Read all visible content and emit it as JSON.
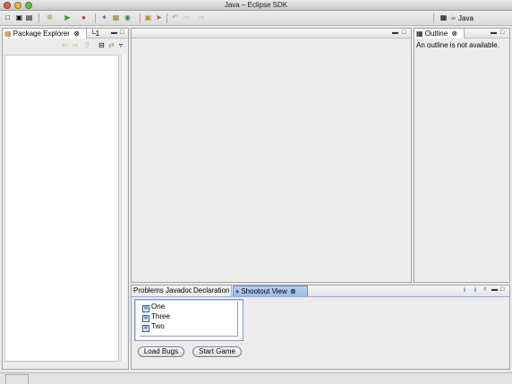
{
  "window": {
    "title": "Java – Eclipse SDK"
  },
  "toolbar": {
    "perspective_label": "Java",
    "icons": [
      "new-icon",
      "save-icon",
      "print-icon",
      "debug-icon",
      "run-icon",
      "external-tools-icon",
      "new-java-project-icon",
      "new-package-icon",
      "new-class-icon",
      "open-type-icon",
      "search-icon",
      "back-icon",
      "forward-icon",
      "open-perspective-icon"
    ]
  },
  "package_explorer": {
    "tab_label": "Package Explorer",
    "hierarchy_tab_label": "1"
  },
  "outline": {
    "tab_label": "Outline",
    "message": "An outline is not available."
  },
  "bottom_panel": {
    "tabs": [
      {
        "label": "Problems"
      },
      {
        "label": "Javadoc"
      },
      {
        "label": "Declaration"
      },
      {
        "label": "Shootout View"
      }
    ],
    "list_items": [
      "One",
      "Three",
      "Two"
    ],
    "load_bugs_label": "Load Bugs",
    "start_game_label": "Start Game"
  },
  "colors": {
    "active_tab": "#9bbbe6",
    "list_border": "#7a9cd4"
  }
}
